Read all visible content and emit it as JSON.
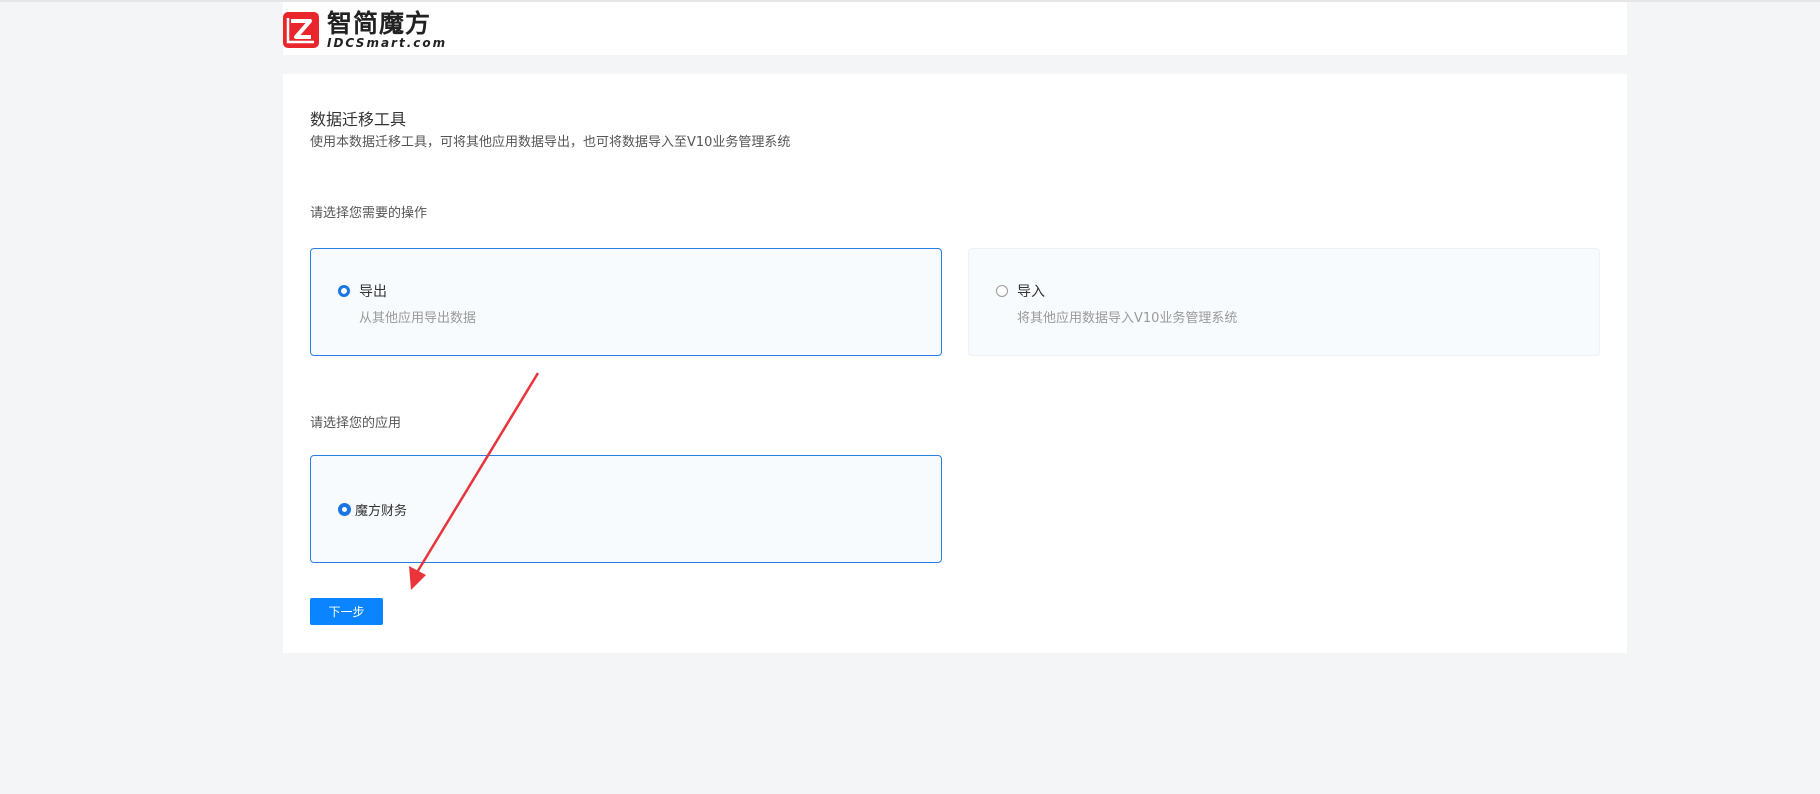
{
  "brand": {
    "name_cn": "智简魔方",
    "name_en": "IDCSmart.com",
    "logo_color": "#e8262b"
  },
  "page": {
    "title": "数据迁移工具",
    "subtitle": "使用本数据迁移工具，可将其他应用数据导出，也可将数据导入至V10业务管理系统"
  },
  "operation": {
    "label": "请选择您需要的操作",
    "options": [
      {
        "label": "导出",
        "desc": "从其他应用导出数据",
        "selected": true
      },
      {
        "label": "导入",
        "desc": "将其他应用数据导入V10业务管理系统",
        "selected": false
      }
    ]
  },
  "application": {
    "label": "请选择您的应用",
    "options": [
      {
        "label": "魔方财务",
        "selected": true
      }
    ]
  },
  "actions": {
    "next_label": "下一步"
  },
  "colors": {
    "accent": "#0a84ff",
    "selected_border": "#2a7fe4",
    "annotation_arrow": "#e8343a"
  }
}
